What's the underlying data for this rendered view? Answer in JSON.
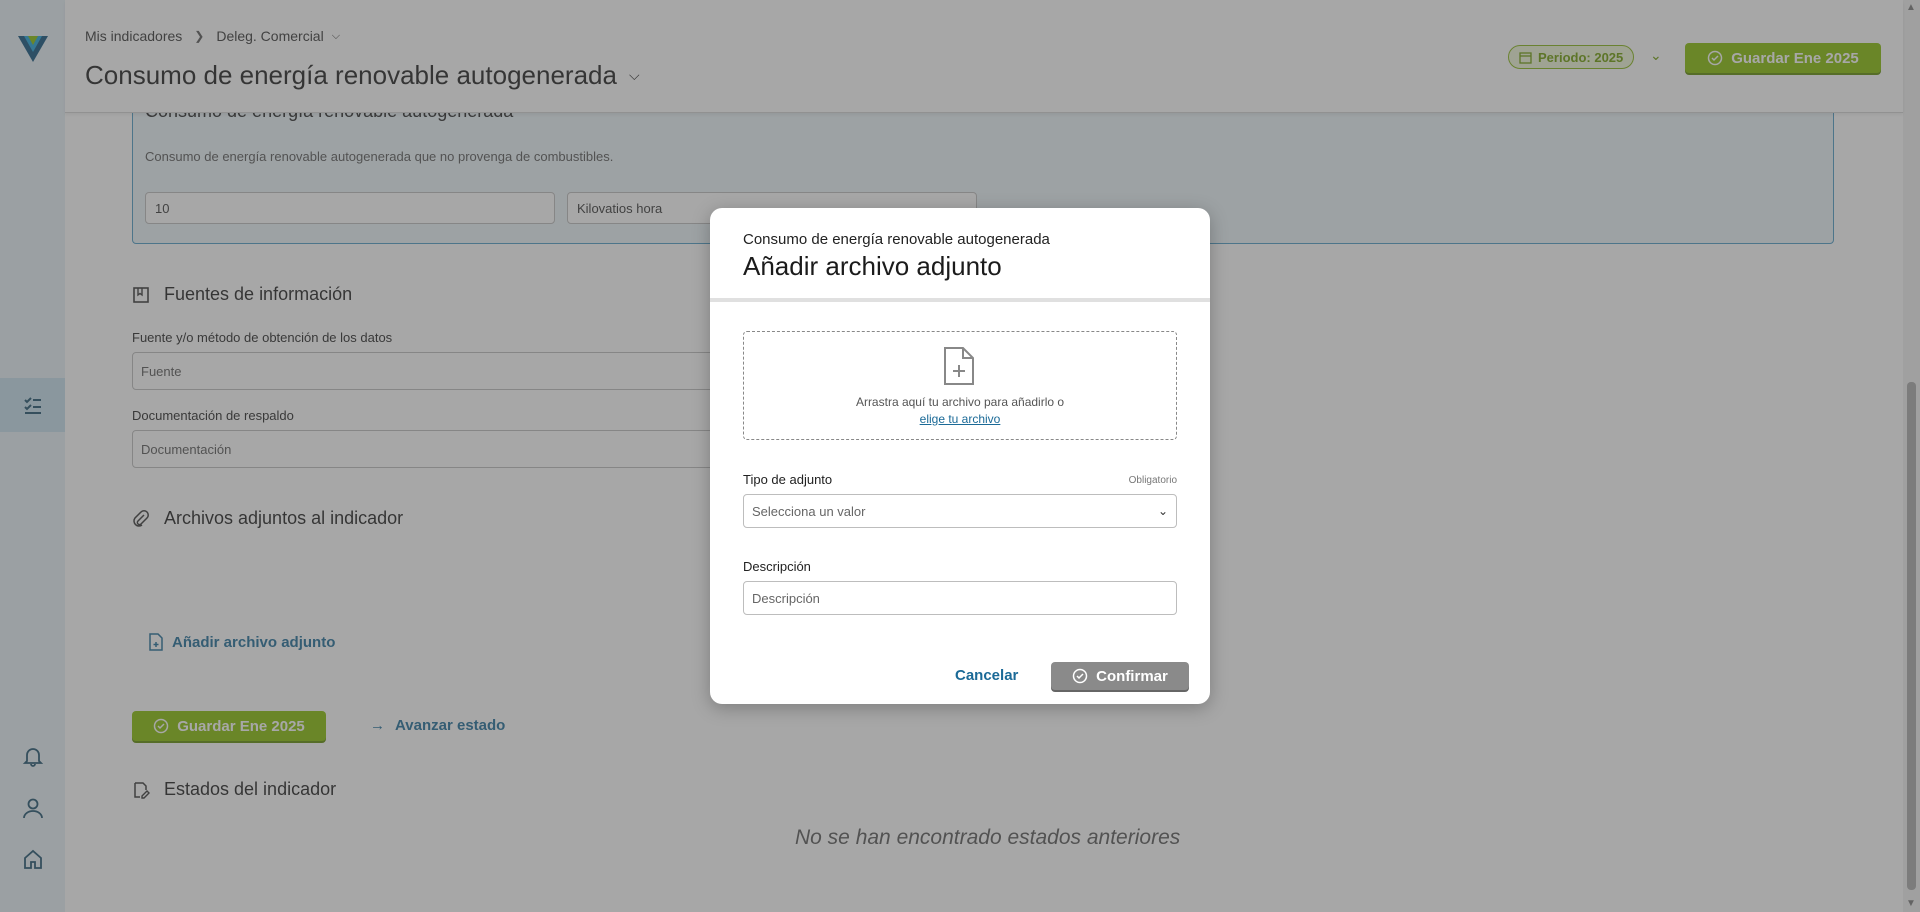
{
  "header": {
    "breadcrumb": [
      "Mis indicadores",
      "Deleg. Comercial"
    ],
    "title": "Consumo de energía renovable autogenerada",
    "periodo": "Periodo: 2025",
    "save_label": "Guardar Ene 2025"
  },
  "card": {
    "title": "Consumo de energía renovable autogenerada",
    "description": "Consumo de energía renovable autogenerada que no provenga de combustibles.",
    "value": "10",
    "unit": "Kilovatios hora"
  },
  "sources": {
    "title": "Fuentes de información",
    "field1_label": "Fuente y/o método de obtención de los datos",
    "field1_placeholder": "Fuente",
    "field2_label": "Documentación de respaldo",
    "field2_placeholder": "Documentación"
  },
  "attachments": {
    "title": "Archivos adjuntos al indicador",
    "add_label": "Añadir archivo adjunto"
  },
  "actions": {
    "save_label": "Guardar Ene 2025",
    "advance_label": "Avanzar estado"
  },
  "states": {
    "title": "Estados del indicador",
    "empty": "No se han encontrado estados anteriores"
  },
  "modal": {
    "subtitle": "Consumo de energía renovable autogenerada",
    "title": "Añadir archivo adjunto",
    "drop_text": "Arrastra aquí tu archivo para añadirlo o",
    "drop_link": "elige tu archivo",
    "type_label": "Tipo de adjunto",
    "type_required": "Obligatorio",
    "type_placeholder": "Selecciona un valor",
    "desc_label": "Descripción",
    "desc_placeholder": "Descripción",
    "cancel_label": "Cancelar",
    "confirm_label": "Confirmar"
  },
  "colors": {
    "accent_green": "#84bd00",
    "link_blue": "#1b6a97",
    "sidebar_bg": "#e6f1f6"
  }
}
